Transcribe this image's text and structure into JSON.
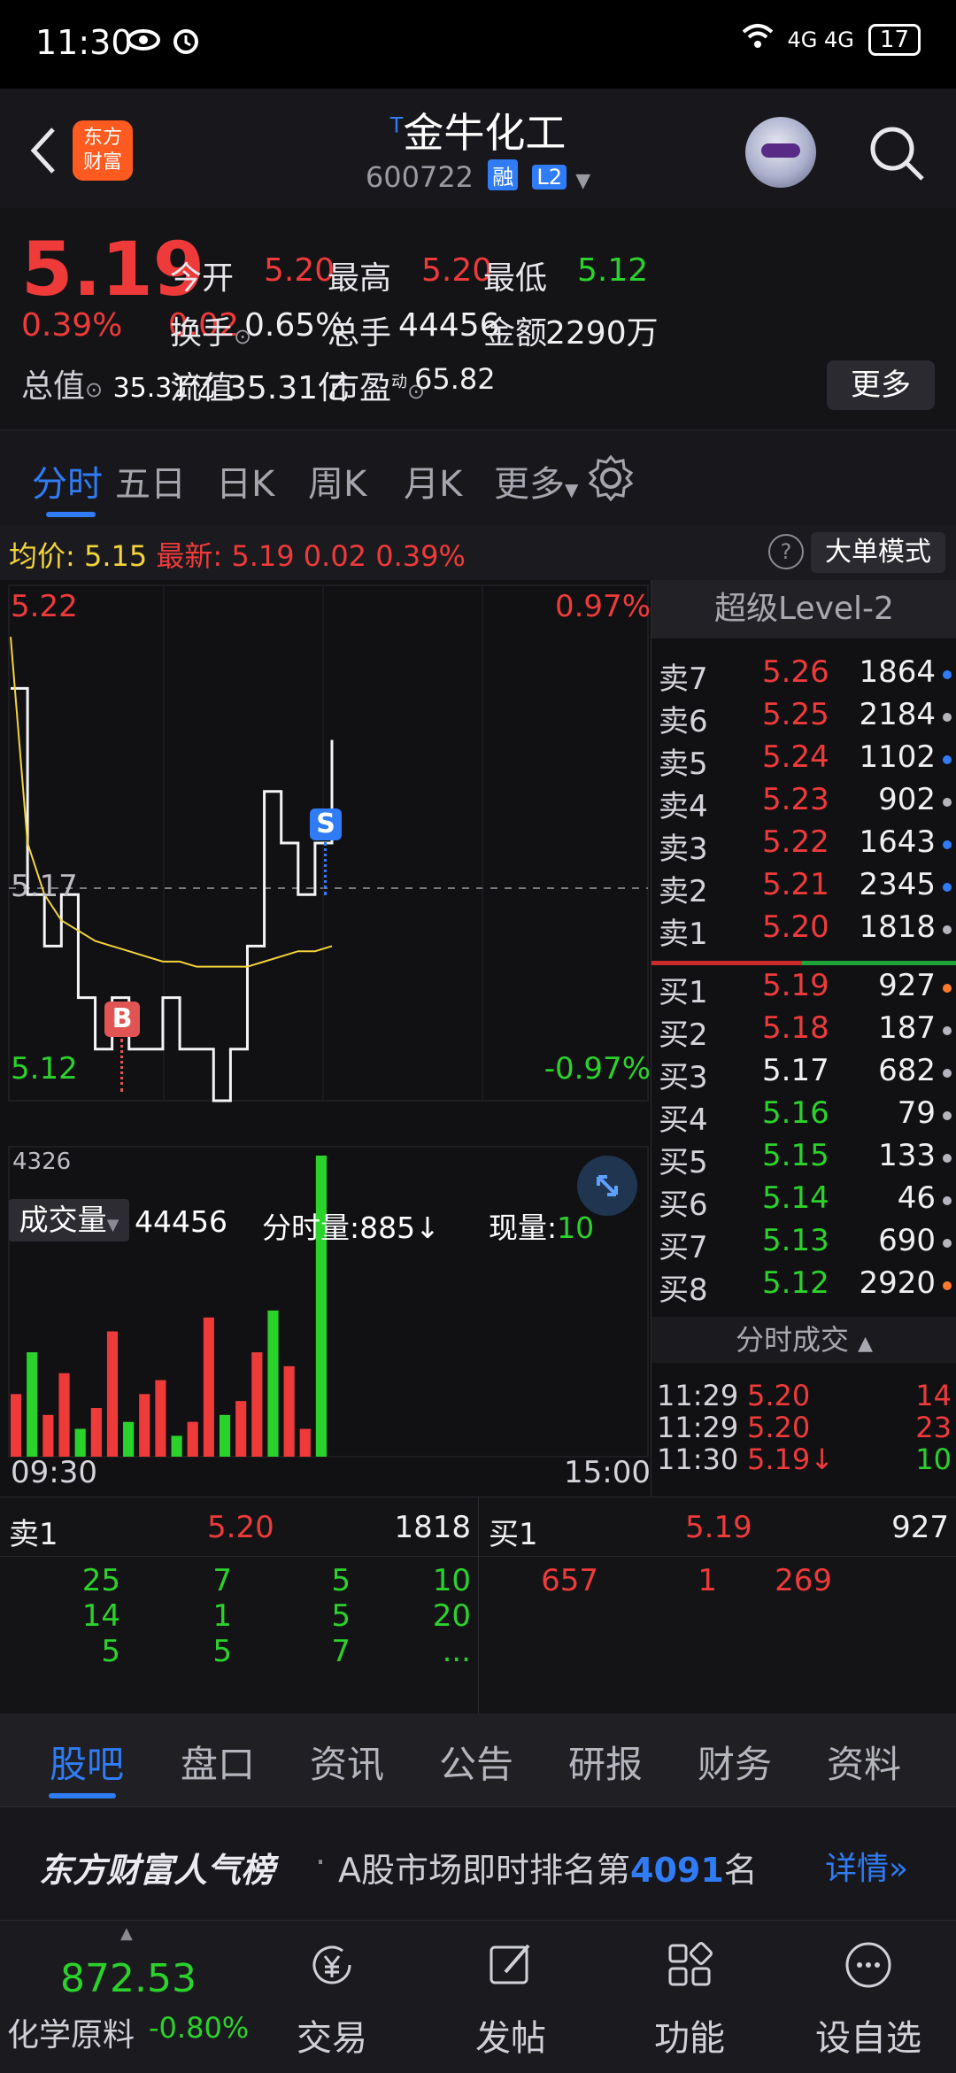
{
  "status_bar": {
    "time": "11:30",
    "network": "4G 4G",
    "battery": "17"
  },
  "header": {
    "logo_line1": "东方",
    "logo_line2": "财富",
    "title_prefix": "T",
    "title": "金牛化工",
    "code": "600722",
    "tag_margin": "融",
    "tag_level": "L2"
  },
  "quote": {
    "price": "5.19",
    "change_pct": "0.39%",
    "change": "0.02",
    "open_label": "今开",
    "open": "5.20",
    "high_label": "最高",
    "high": "5.20",
    "low_label": "最低",
    "low": "5.12",
    "turnover_label": "换手",
    "turnover": "0.65%",
    "volume_label": "总手",
    "volume": "44456",
    "amount_label": "金额",
    "amount": "2290万",
    "mktcap_label": "总值",
    "mktcap": "35.31亿",
    "float_label": "流值",
    "float": "35.31亿",
    "pe_label": "市盈",
    "pe_sup": "动",
    "pe": "65.82",
    "more_button": "更多"
  },
  "tabs": {
    "items": [
      "分时",
      "五日",
      "日K",
      "周K",
      "月K",
      "更多"
    ],
    "active": "分时"
  },
  "info_bar": {
    "avg_label": "均价:",
    "avg": "5.15",
    "latest_label": "最新:",
    "latest": "5.19",
    "latest_chg": "0.02",
    "latest_pct": "0.39%",
    "help": "?",
    "big_order_mode": "大单模式"
  },
  "chart": {
    "top_price": "5.22",
    "mid_price": "5.17",
    "bottom_price": "5.12",
    "top_pct": "0.97%",
    "bottom_pct": "-0.97%",
    "marker_sell": "S",
    "marker_buy": "B",
    "volume_selector": "成交量",
    "total_volume": "44456",
    "tick_volume_label": "分时量:885",
    "current_label": "现量:",
    "current_volume": "10",
    "volume_max": "4326",
    "time_start": "09:30",
    "time_end": "15:00"
  },
  "chart_data": {
    "type": "line",
    "ylim": [
      5.12,
      5.22
    ],
    "series": [
      {
        "name": "分时",
        "values": [
          5.2,
          5.16,
          5.15,
          5.16,
          5.14,
          5.13,
          5.14,
          5.13,
          5.13,
          5.14,
          5.13,
          5.13,
          5.12,
          5.13,
          5.15,
          5.18,
          5.17,
          5.16,
          5.17,
          5.19
        ]
      },
      {
        "name": "均价",
        "values": [
          5.21,
          5.17,
          5.16,
          5.155,
          5.153,
          5.151,
          5.15,
          5.149,
          5.148,
          5.147,
          5.147,
          5.146,
          5.146,
          5.146,
          5.146,
          5.147,
          5.148,
          5.149,
          5.149,
          5.15
        ]
      }
    ],
    "volumes": [
      900,
      1500,
      600,
      1200,
      400,
      700,
      1800,
      500,
      900,
      1100,
      300,
      500,
      2000,
      600,
      800,
      1500,
      2100,
      1300,
      400,
      4326
    ]
  },
  "order_book": {
    "header": "超级Level-2",
    "asks": [
      {
        "label": "卖7",
        "price": "5.26",
        "volume": "1864",
        "dot": "blue"
      },
      {
        "label": "卖6",
        "price": "5.25",
        "volume": "2184",
        "dot": "grey"
      },
      {
        "label": "卖5",
        "price": "5.24",
        "volume": "1102",
        "dot": "blue"
      },
      {
        "label": "卖4",
        "price": "5.23",
        "volume": "902",
        "dot": "grey"
      },
      {
        "label": "卖3",
        "price": "5.22",
        "volume": "1643",
        "dot": "blue"
      },
      {
        "label": "卖2",
        "price": "5.21",
        "volume": "2345",
        "dot": "blue"
      },
      {
        "label": "卖1",
        "price": "5.20",
        "volume": "1818",
        "dot": "grey"
      }
    ],
    "bids": [
      {
        "label": "买1",
        "price": "5.19",
        "volume": "927",
        "dot": "orange",
        "color": "red"
      },
      {
        "label": "买2",
        "price": "5.18",
        "volume": "187",
        "dot": "grey",
        "color": "red"
      },
      {
        "label": "买3",
        "price": "5.17",
        "volume": "682",
        "dot": "grey",
        "color": "white"
      },
      {
        "label": "买4",
        "price": "5.16",
        "volume": "79",
        "dot": "grey",
        "color": "green"
      },
      {
        "label": "买5",
        "price": "5.15",
        "volume": "133",
        "dot": "grey",
        "color": "green"
      },
      {
        "label": "买6",
        "price": "5.14",
        "volume": "46",
        "dot": "grey",
        "color": "green"
      },
      {
        "label": "买7",
        "price": "5.13",
        "volume": "690",
        "dot": "grey",
        "color": "green"
      },
      {
        "label": "买8",
        "price": "5.12",
        "volume": "2920",
        "dot": "orange",
        "color": "green"
      }
    ],
    "trades_header": "分时成交",
    "trades": [
      {
        "time": "11:29",
        "price": "5.20",
        "volume": "14",
        "color": "red"
      },
      {
        "time": "11:29",
        "price": "5.20",
        "volume": "23",
        "color": "red"
      },
      {
        "time": "11:30",
        "price": "5.19↓",
        "volume": "10",
        "color": "green"
      }
    ]
  },
  "queue": {
    "ask_label": "卖1",
    "ask_price": "5.20",
    "ask_total": "1818",
    "bid_label": "买1",
    "bid_price": "5.19",
    "bid_total": "927",
    "ask_rows": [
      [
        "25",
        "7",
        "5",
        "10"
      ],
      [
        "14",
        "1",
        "5",
        "20"
      ],
      [
        "5",
        "5",
        "7",
        "..."
      ]
    ],
    "bid_rows": [
      [
        "657",
        "1",
        "269"
      ]
    ]
  },
  "bottom_tabs": {
    "items": [
      "股吧",
      "盘口",
      "资讯",
      "公告",
      "研报",
      "财务",
      "资料"
    ],
    "active": "股吧"
  },
  "popularity": {
    "brand": "东方财富人气榜",
    "sep": "·",
    "text_prefix": "A股市场即时排名第",
    "rank": "4091",
    "text_suffix": "名",
    "detail": "详情"
  },
  "nav": {
    "index_value": "872.53",
    "index_name": "化学原料",
    "index_change": "-0.80%",
    "items": [
      "交易",
      "发帖",
      "功能",
      "设自选"
    ]
  },
  "colors": {
    "up": "#ef3a3a",
    "down": "#2bd22b",
    "accent": "#2f7cf6",
    "avg_line": "#f3d43a"
  }
}
